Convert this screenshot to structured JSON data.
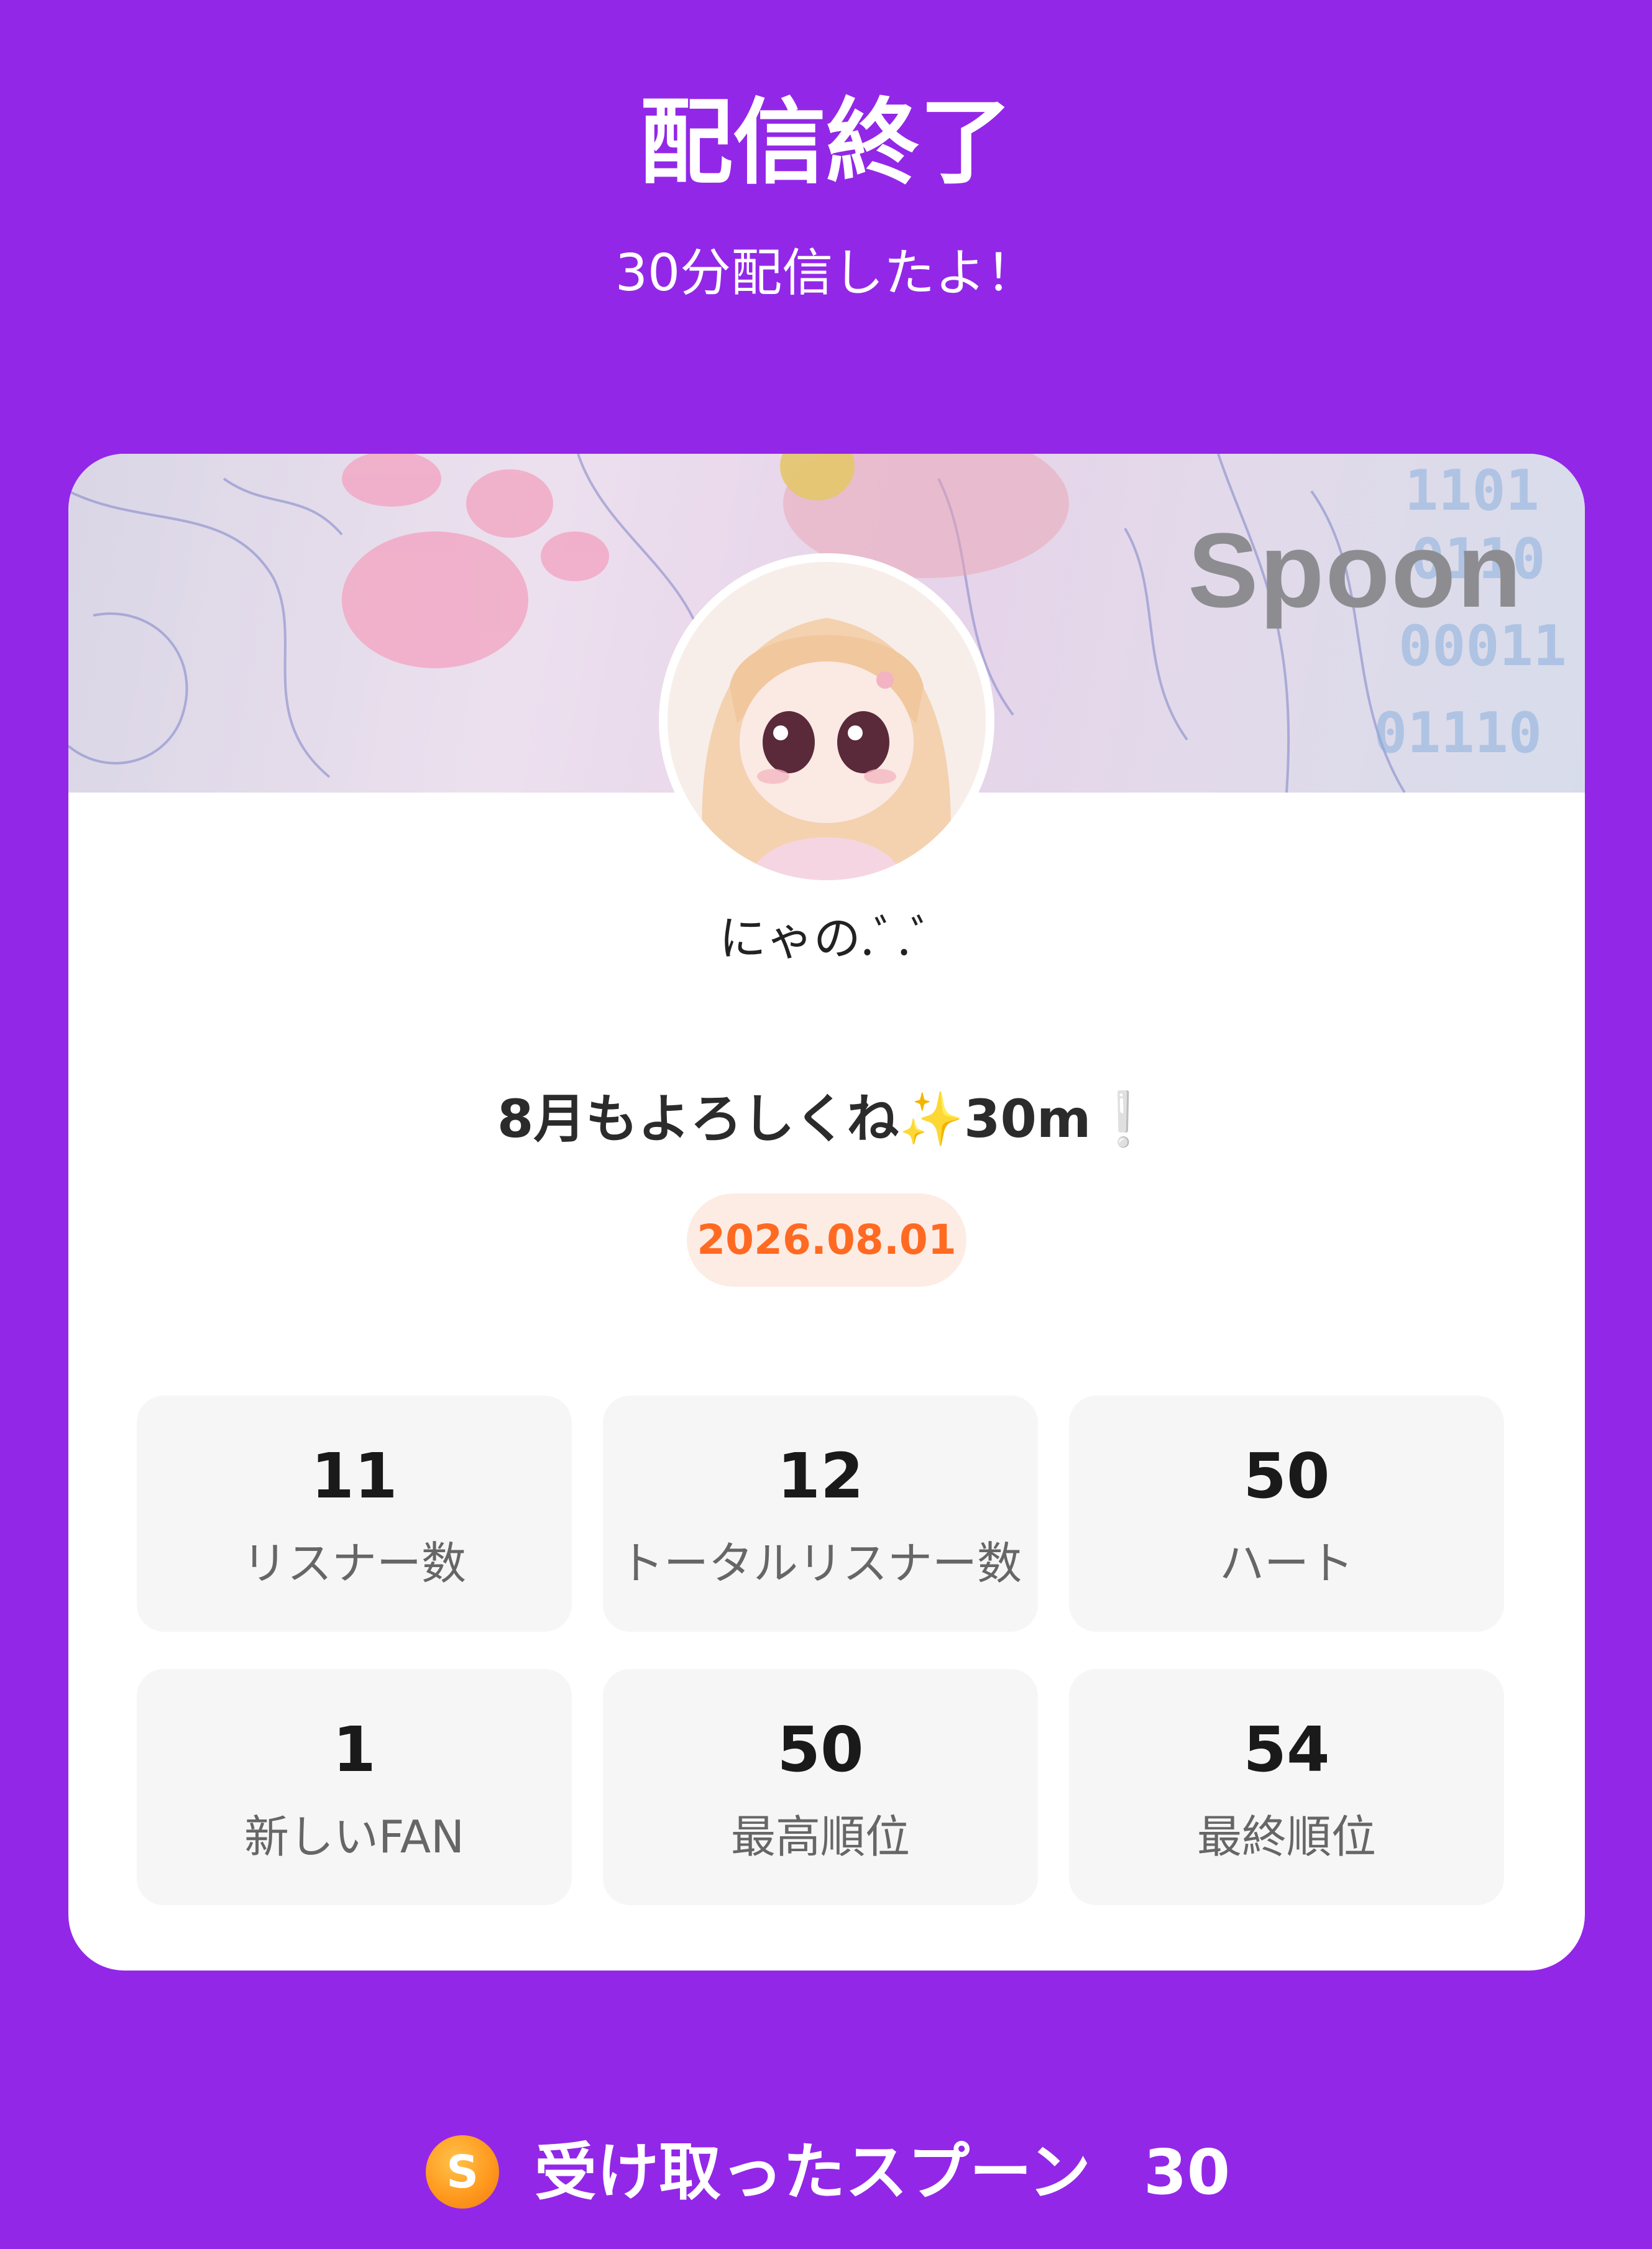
{
  "header": {
    "title": "配信終了",
    "subtitle": "30分配信したよ！"
  },
  "card": {
    "banner_logo": "Spoon",
    "username": "にゃの.ﾞ.ﾞ",
    "live_title": "8月もよろしくね✨30m❕",
    "date": "2026.08.01",
    "stats": [
      {
        "value": "11",
        "label": "リスナー数"
      },
      {
        "value": "12",
        "label": "トータルリスナー数"
      },
      {
        "value": "50",
        "label": "ハート"
      },
      {
        "value": "1",
        "label": "新しいFAN"
      },
      {
        "value": "50",
        "label": "最高順位"
      },
      {
        "value": "54",
        "label": "最終順位"
      }
    ]
  },
  "footer": {
    "coin_icon": "S",
    "spoons_label": "受け取ったスプーン",
    "spoons_count": "30"
  },
  "colors": {
    "background": "#9327e8",
    "date_text": "#ff6a22",
    "date_badge_bg": "#fdece4",
    "coin": "#ff9a1f"
  }
}
